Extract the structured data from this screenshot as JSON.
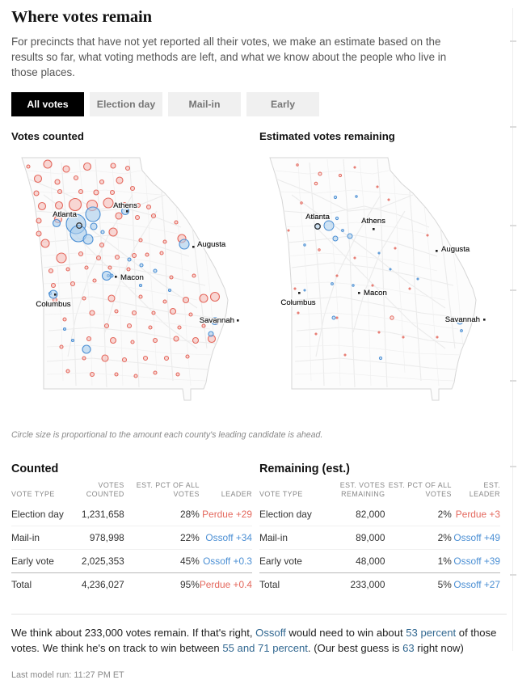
{
  "headline": "Where votes remain",
  "intro": "For precincts that have not yet reported all their votes, we make an estimate based on the results so far, what voting methods are left, and what we know about the people who live in those places.",
  "tabs": [
    {
      "label": "All votes",
      "active": true
    },
    {
      "label": "Election day",
      "active": false
    },
    {
      "label": "Mail-in",
      "active": false
    },
    {
      "label": "Early",
      "active": false
    }
  ],
  "maps": {
    "left": {
      "title": "Votes counted",
      "cities": [
        "Atlanta",
        "Athens",
        "Augusta",
        "Macon",
        "Columbus",
        "Savannah"
      ]
    },
    "right": {
      "title": "Estimated votes remaining",
      "cities": [
        "Atlanta",
        "Athens",
        "Augusta",
        "Macon",
        "Columbus",
        "Savannah"
      ]
    },
    "caption": "Circle size is proportional to the amount each county's leading candidate is ahead."
  },
  "colors": {
    "republican": "#e4685d",
    "democrat": "#4b8fd4",
    "link": "#326891",
    "active_tab_bg": "#000000",
    "tab_bg": "#f0f0f0"
  },
  "counted": {
    "title": "Counted",
    "headers": [
      "VOTE TYPE",
      "VOTES COUNTED",
      "EST. PCT OF ALL VOTES",
      "LEADER"
    ],
    "rows": [
      {
        "type": "Election day",
        "votes": "1,231,658",
        "pct": "28%",
        "leader": "Perdue +29",
        "party": "r"
      },
      {
        "type": "Mail-in",
        "votes": "978,998",
        "pct": "22%",
        "leader": "Ossoff +34",
        "party": "d"
      },
      {
        "type": "Early vote",
        "votes": "2,025,353",
        "pct": "45%",
        "leader": "Ossoff +0.3",
        "party": "d"
      },
      {
        "type": "Total",
        "votes": "4,236,027",
        "pct": "95%",
        "leader": "Perdue +0.4",
        "party": "r"
      }
    ]
  },
  "remaining": {
    "title": "Remaining (est.)",
    "headers": [
      "VOTE TYPE",
      "EST. VOTES REMAINING",
      "EST. PCT OF ALL VOTES",
      "EST. LEADER"
    ],
    "rows": [
      {
        "type": "Election day",
        "votes": "82,000",
        "pct": "2%",
        "leader": "Perdue +3",
        "party": "r"
      },
      {
        "type": "Mail-in",
        "votes": "89,000",
        "pct": "2%",
        "leader": "Ossoff +49",
        "party": "d"
      },
      {
        "type": "Early vote",
        "votes": "48,000",
        "pct": "1%",
        "leader": "Ossoff +39",
        "party": "d"
      },
      {
        "type": "Total",
        "votes": "233,000",
        "pct": "5%",
        "leader": "Ossoff +27",
        "party": "d"
      }
    ]
  },
  "summary": {
    "t1": "We think about 233,000 votes remain. If that's right, ",
    "link1": "Ossoff",
    "t2": " would need to win about ",
    "link2": "53 percent",
    "t3": " of those votes. We think he's on track to win between ",
    "link3": "55 and 71 percent",
    "t4": ". (Our best guess is ",
    "link4": "63",
    "t5": " right now)"
  },
  "lastrun": "Last model run: 11:27 PM ET",
  "chart_data": {
    "type": "map",
    "title": "Where votes remain — Georgia counties",
    "panels": [
      {
        "name": "Votes counted",
        "description": "Proportional symbol map of Georgia counties; circle radius scales with the lead margin of the county's leading candidate.",
        "dominant_color": "republican-red",
        "note": "Dense red circles statewide; large blue circles clustered around Atlanta metro."
      },
      {
        "name": "Estimated votes remaining",
        "description": "Same county geography; far fewer and much smaller circles, mostly blue and concentrated near Atlanta.",
        "dominant_color": "democrat-blue",
        "note": "233,000 votes estimated remaining statewide."
      }
    ],
    "legend": "Circle size is proportional to the amount each county's leading candidate is ahead.",
    "labeled_cities": [
      "Atlanta",
      "Athens",
      "Augusta",
      "Macon",
      "Columbus",
      "Savannah"
    ],
    "tables": [
      {
        "title": "Counted",
        "columns": [
          "VOTE TYPE",
          "VOTES COUNTED",
          "EST. PCT OF ALL VOTES",
          "LEADER"
        ],
        "rows": [
          [
            "Election day",
            1231658,
            28,
            "Perdue +29"
          ],
          [
            "Mail-in",
            978998,
            22,
            "Ossoff +34"
          ],
          [
            "Early vote",
            2025353,
            45,
            "Ossoff +0.3"
          ],
          [
            "Total",
            4236027,
            95,
            "Perdue +0.4"
          ]
        ]
      },
      {
        "title": "Remaining (est.)",
        "columns": [
          "VOTE TYPE",
          "EST. VOTES REMAINING",
          "EST. PCT OF ALL VOTES",
          "EST. LEADER"
        ],
        "rows": [
          [
            "Election day",
            82000,
            2,
            "Perdue +3"
          ],
          [
            "Mail-in",
            89000,
            2,
            "Ossoff +49"
          ],
          [
            "Early vote",
            48000,
            1,
            "Ossoff +39"
          ],
          [
            "Total",
            233000,
            5,
            "Ossoff +27"
          ]
        ]
      }
    ]
  }
}
